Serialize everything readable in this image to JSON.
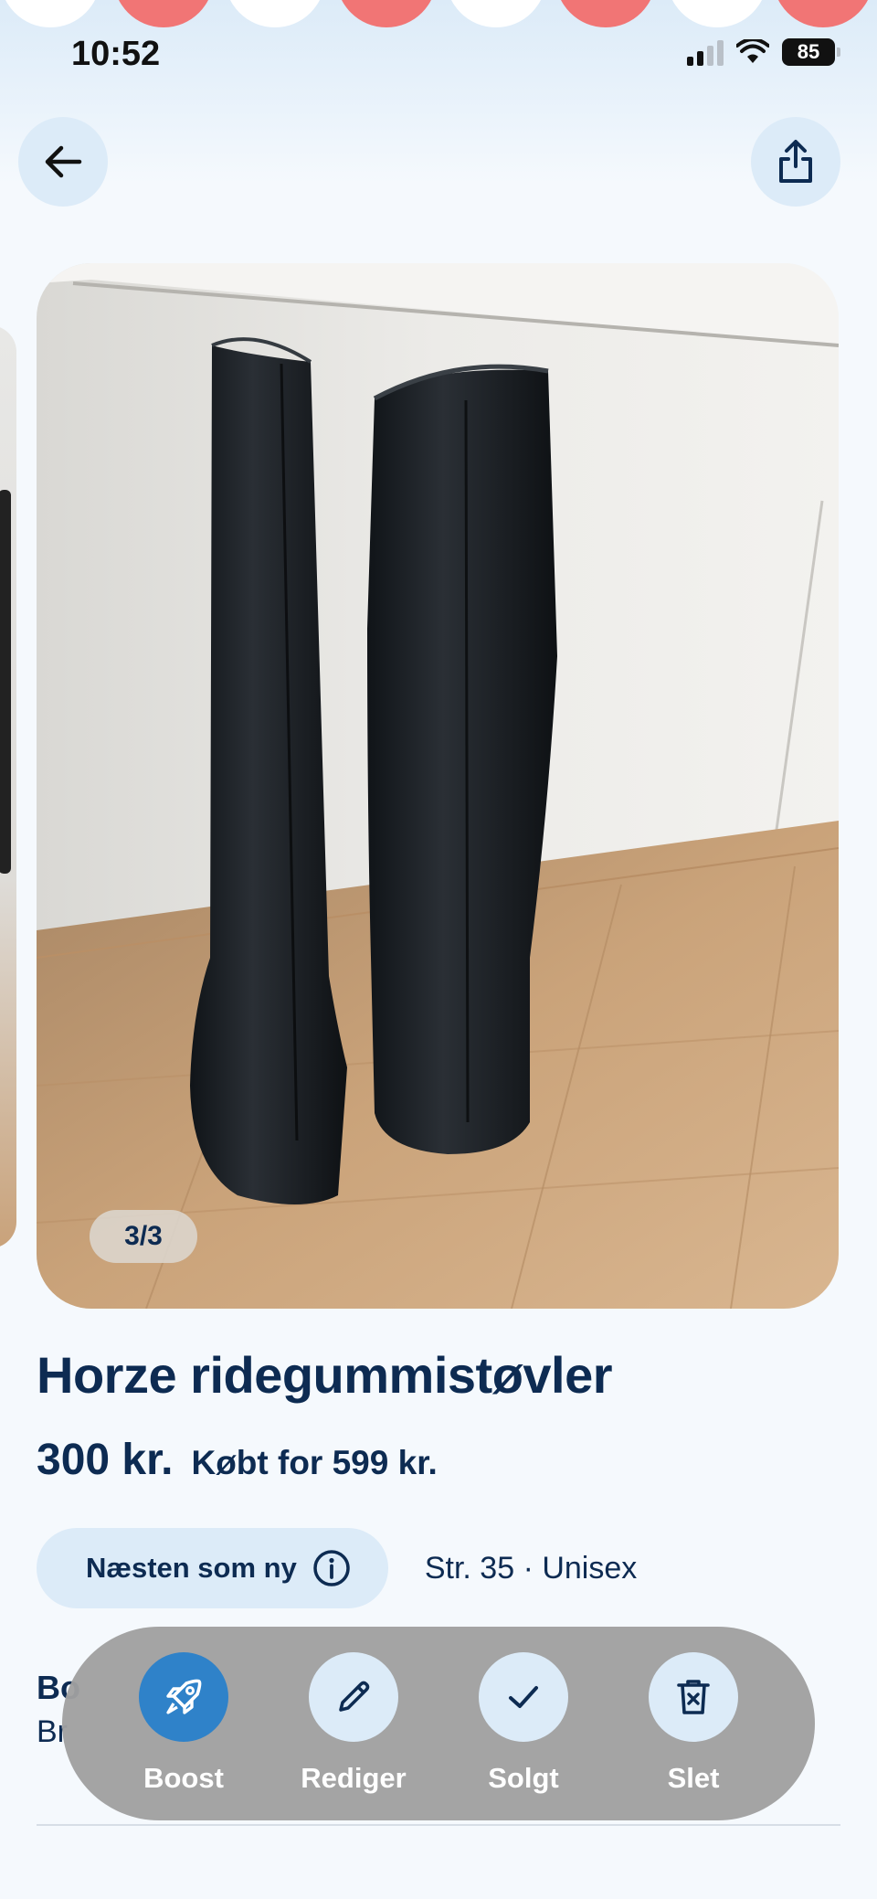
{
  "status_bar": {
    "time": "10:52",
    "battery": "85"
  },
  "header": {
    "back_icon": "arrow-left-icon",
    "share_icon": "share-icon"
  },
  "gallery": {
    "counter": "3/3"
  },
  "product": {
    "title": "Horze ridegummistøvler",
    "price": "300 kr.",
    "original_price": "Købt for 599 kr.",
    "condition": "Næsten som ny",
    "size_gender": "Str. 35 · Unisex",
    "brand_label_peek": "Bo",
    "brand_value_peek": "Br"
  },
  "actions": [
    {
      "label": "Boost",
      "icon": "rocket-icon"
    },
    {
      "label": "Rediger",
      "icon": "pencil-icon"
    },
    {
      "label": "Solgt",
      "icon": "check-icon"
    },
    {
      "label": "Slet",
      "icon": "trash-icon"
    }
  ],
  "colors": {
    "primary_text": "#0d2b52",
    "accent_blue": "#2f82c9",
    "pill_bg": "#dcebf8",
    "bubble_red": "#f17575"
  }
}
